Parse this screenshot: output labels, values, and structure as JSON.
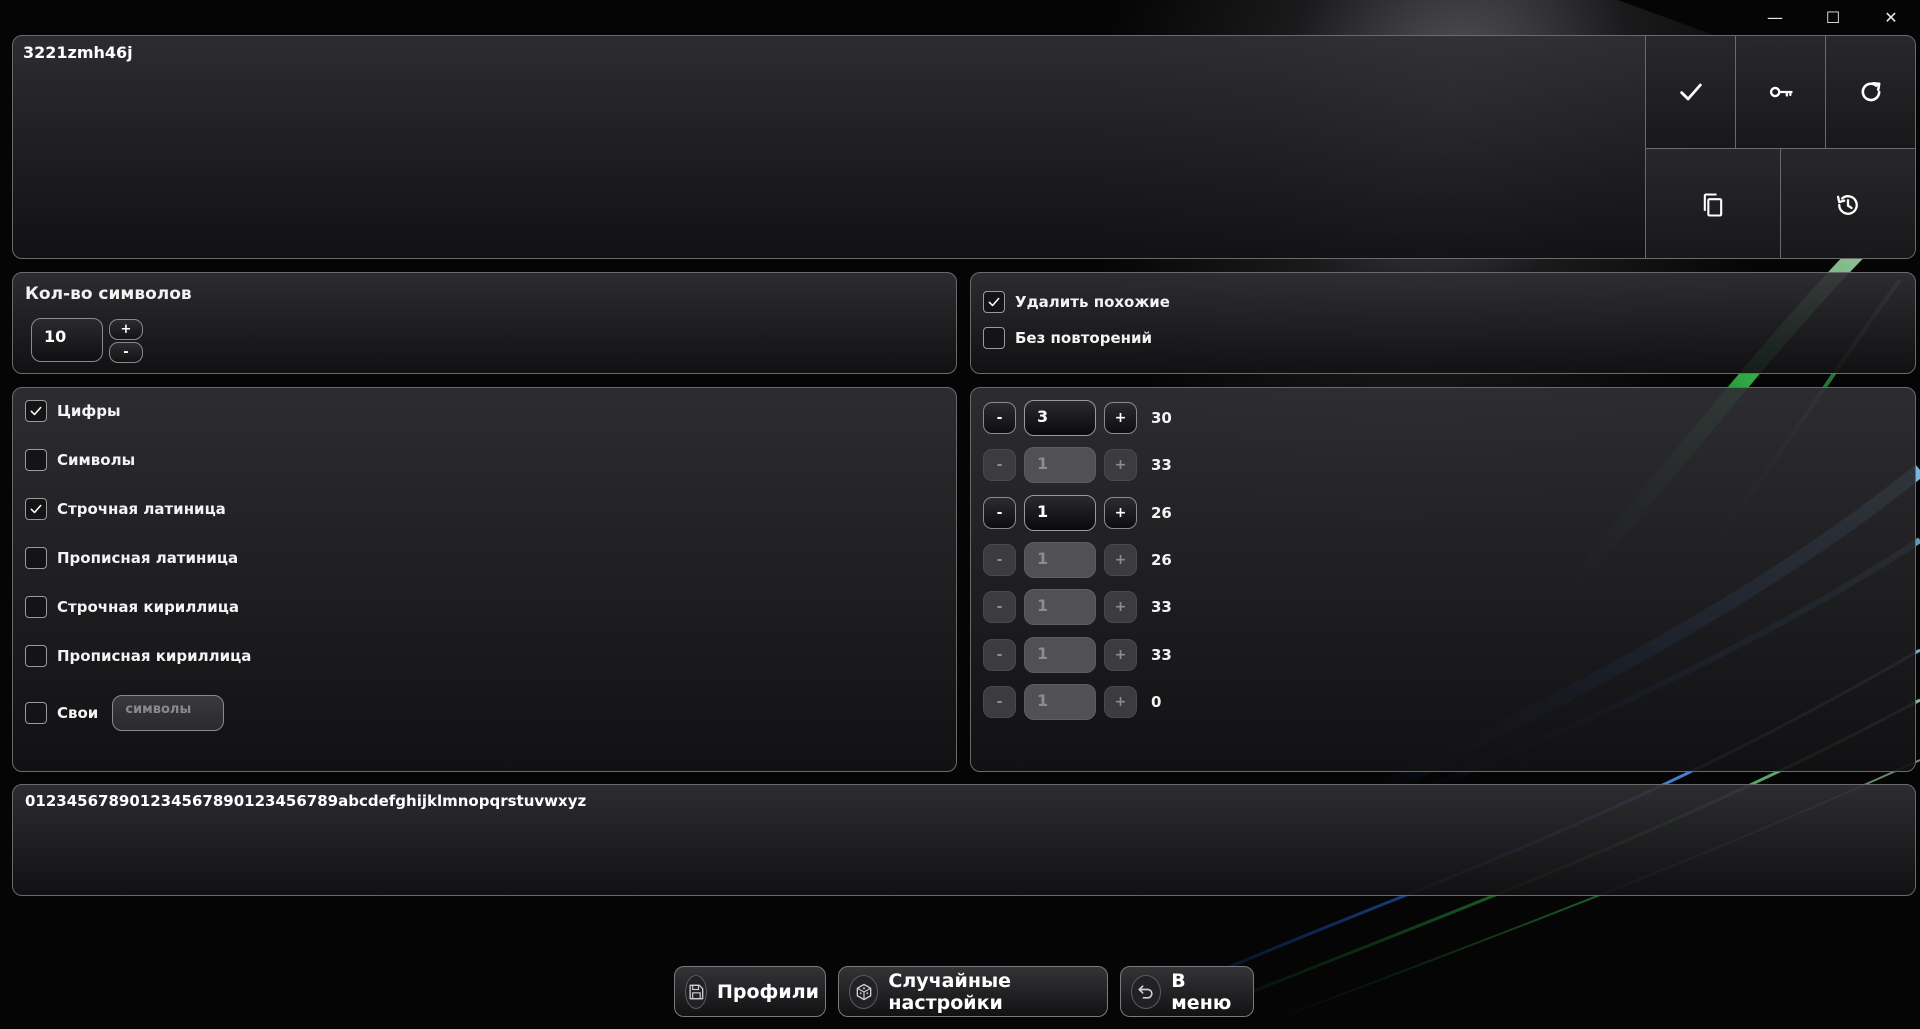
{
  "output": {
    "text": "3221zmh46j"
  },
  "length": {
    "title": "Кол-во символов",
    "value": "10",
    "plus": "+",
    "minus": "-"
  },
  "options": [
    {
      "label": "Удалить похожие",
      "checked": true
    },
    {
      "label": "Без повторений",
      "checked": false
    }
  ],
  "charsets": [
    {
      "label": "Цифры",
      "checked": true
    },
    {
      "label": "Символы",
      "checked": false
    },
    {
      "label": "Строчная латиница",
      "checked": true
    },
    {
      "label": "Прописная латиница",
      "checked": false
    },
    {
      "label": "Строчная кириллица",
      "checked": false
    },
    {
      "label": "Прописная кириллица",
      "checked": false
    },
    {
      "label": "Свои",
      "checked": false
    }
  ],
  "custom": {
    "placeholder": "символы"
  },
  "counts": [
    {
      "minus": "-",
      "value": "3",
      "plus": "+",
      "total": "30",
      "enabled": true
    },
    {
      "minus": "-",
      "value": "1",
      "plus": "+",
      "total": "33",
      "enabled": false
    },
    {
      "minus": "-",
      "value": "1",
      "plus": "+",
      "total": "26",
      "enabled": true
    },
    {
      "minus": "-",
      "value": "1",
      "plus": "+",
      "total": "26",
      "enabled": false
    },
    {
      "minus": "-",
      "value": "1",
      "plus": "+",
      "total": "33",
      "enabled": false
    },
    {
      "minus": "-",
      "value": "1",
      "plus": "+",
      "total": "33",
      "enabled": false
    },
    {
      "minus": "-",
      "value": "1",
      "plus": "+",
      "total": "0",
      "enabled": false
    }
  ],
  "alphabet": {
    "text": "012345678901234567890123456789abcdefghijklmnopqrstuvwxyz"
  },
  "bottom": {
    "profiles": {
      "label": "Профили",
      "icon": "save-icon"
    },
    "random": {
      "label": "Случайные настройки",
      "icon": "dice-icon"
    },
    "menu": {
      "label": "В меню",
      "icon": "undo-icon"
    }
  },
  "window_controls": {
    "minimize": "—",
    "maximize": "☐",
    "close": "✕"
  },
  "colors": {
    "accent_green": "#3ddc5a",
    "accent_blue": "#2f7dff",
    "panel_border": "#6a6a6a"
  }
}
